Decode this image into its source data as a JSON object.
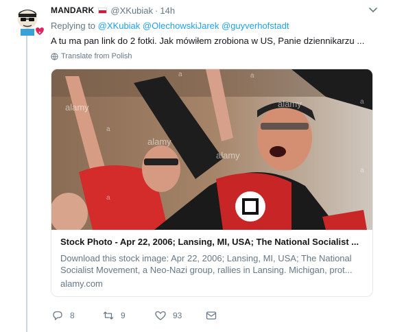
{
  "tweet": {
    "display_name": "MANDARK",
    "handle": "@XKubiak",
    "dot": "·",
    "time": "14h",
    "replying_prefix": "Replying to",
    "mentions": [
      "@XKubiak",
      "@OlechowskiJarek",
      "@guyverhofstadt"
    ],
    "text": "A tu ma pan link do 2 fotki. Jak mówiłem zrobiona w US, Panie dziennikarzu ...",
    "translate_label": "Translate from Polish"
  },
  "card": {
    "title": "Stock Photo - Apr 22, 2006; Lansing, MI, USA; The National Socialist ...",
    "description": "Download this stock image: Apr 22, 2006; Lansing, MI, USA; The National Socialist Movement, a Neo-Nazi group, rallies in Lansing. Michigan, prot...",
    "domain": "alamy.com",
    "watermark_text": "alamy",
    "watermark_a": "a"
  },
  "actions": {
    "reply_count": "8",
    "retweet_count": "9",
    "like_count": "93"
  },
  "icons": {
    "avatar": "cartoon-avatar-icon",
    "flag": "poland-flag-icon",
    "menu": "chevron-down-icon",
    "translate": "globe-icon",
    "reply": "reply-icon",
    "retweet": "retweet-icon",
    "like": "heart-icon",
    "message": "direct-message-icon"
  },
  "colors": {
    "link": "#1da1f2",
    "secondary_text": "#657786",
    "primary_text": "#14171a",
    "border": "#e1e8ed",
    "flag_red": "#dc143c"
  }
}
